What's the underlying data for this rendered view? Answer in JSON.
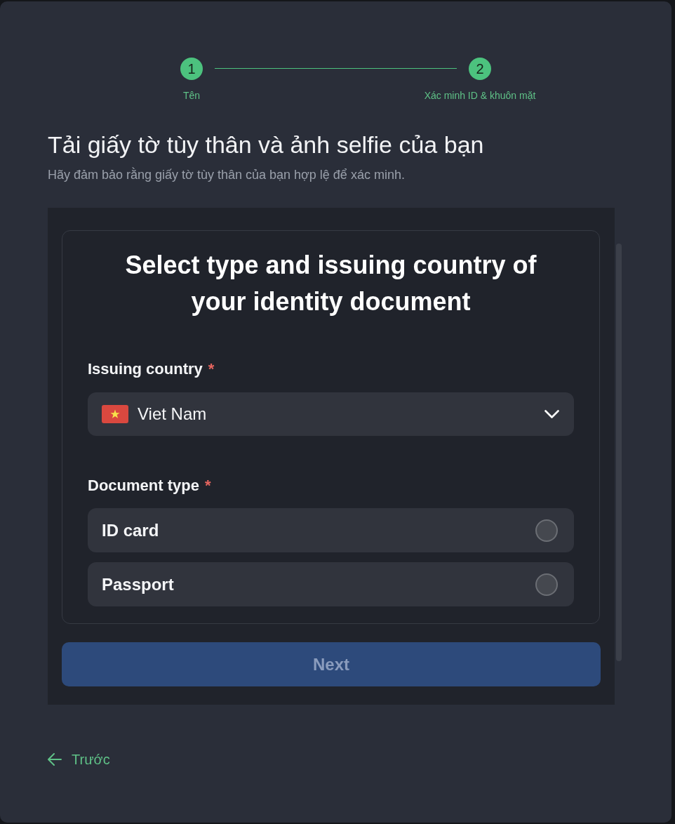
{
  "stepper": {
    "steps": [
      {
        "number": "1",
        "label": "Tên",
        "active": true
      },
      {
        "number": "2",
        "label": "Xác minh ID & khuôn mặt",
        "active": true
      }
    ]
  },
  "heading": "Tải giấy tờ tùy thân và ảnh selfie của bạn",
  "subtitle": "Hãy đảm bảo rằng giấy tờ tùy thân của bạn hợp lệ để xác minh.",
  "verification": {
    "title": "Select type and issuing country of your identity document",
    "country_field": {
      "label": "Issuing country",
      "required_mark": "*",
      "value": "Viet Nam"
    },
    "document_type": {
      "label": "Document type",
      "required_mark": "*",
      "options": [
        {
          "label": "ID card",
          "selected": false
        },
        {
          "label": "Passport",
          "selected": false
        }
      ]
    },
    "next_button": {
      "label": "Next",
      "disabled": true
    }
  },
  "back_link": {
    "label": "Trước"
  }
}
